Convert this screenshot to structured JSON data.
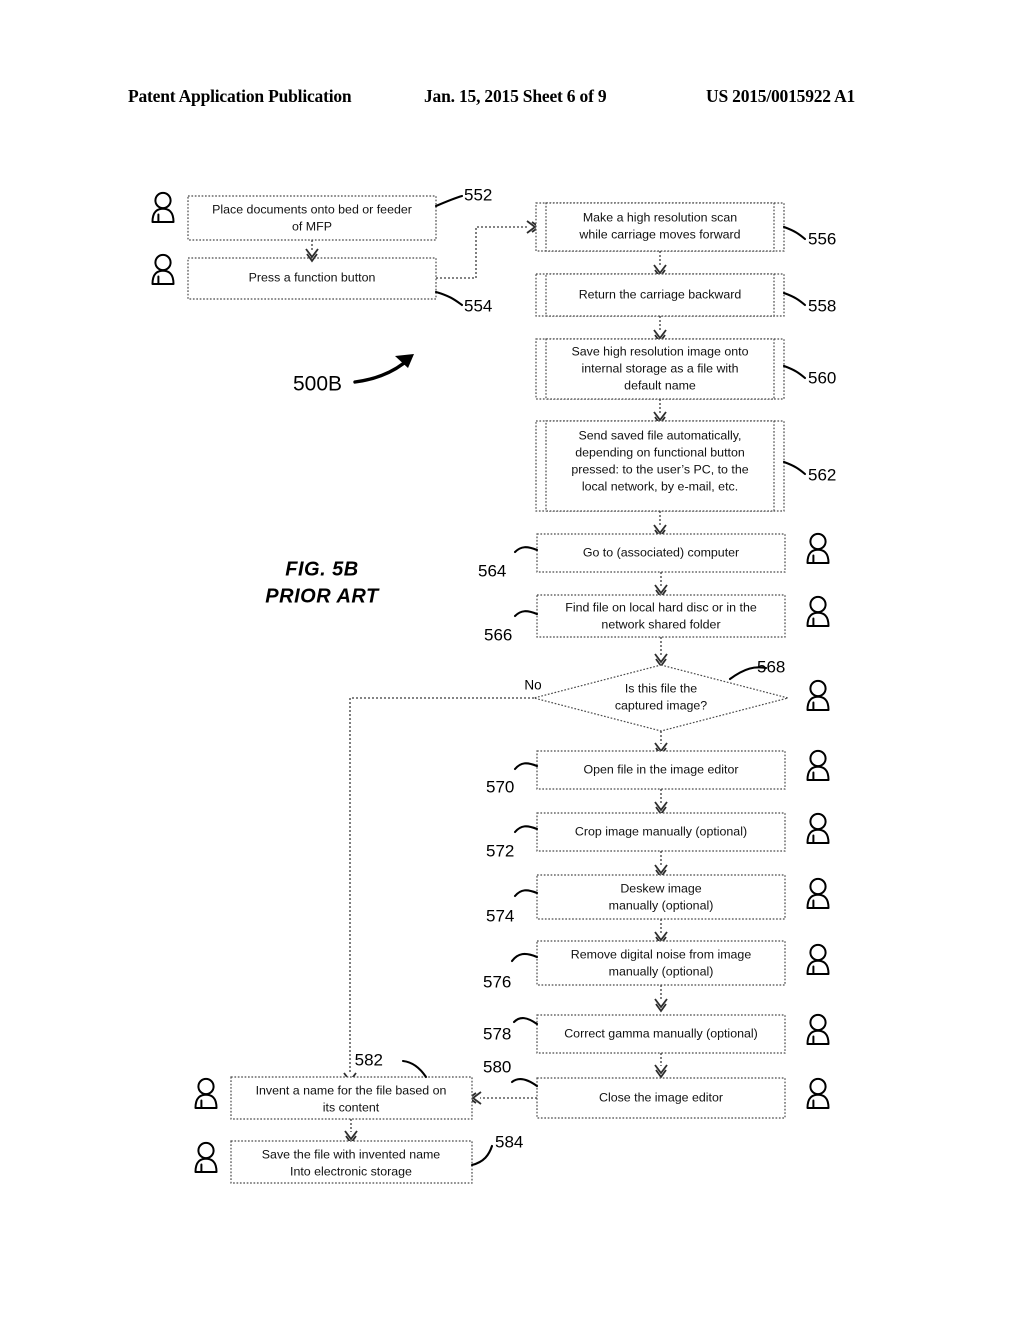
{
  "header": {
    "publication": "Patent Application Publication",
    "date_sheet": "Jan. 15, 2015  Sheet 6 of 9",
    "patent_number": "US 2015/0015922 A1"
  },
  "figure": {
    "label_line1": "FIG. 5B",
    "label_line2": "PRIOR ART",
    "diagram_ref": "500B",
    "no_branch_label": "No"
  },
  "nodes": [
    {
      "ref": "552",
      "type": "process",
      "actor": "person",
      "lines": [
        "Place documents onto bed or feeder",
        "of MFP"
      ]
    },
    {
      "ref": "554",
      "type": "process",
      "actor": "person",
      "lines": [
        "Press a function button"
      ]
    },
    {
      "ref": "556",
      "type": "machine",
      "actor": "none",
      "lines": [
        "Make a high resolution scan",
        "while carriage moves forward"
      ]
    },
    {
      "ref": "558",
      "type": "machine",
      "actor": "none",
      "lines": [
        "Return the carriage backward"
      ]
    },
    {
      "ref": "560",
      "type": "machine",
      "actor": "none",
      "lines": [
        "Save high resolution image onto",
        "internal storage as a file with",
        "default name"
      ]
    },
    {
      "ref": "562",
      "type": "machine",
      "actor": "none",
      "lines": [
        "Send saved file automatically,",
        "depending on functional button",
        "pressed: to the user’s PC, to the",
        "local network, by e-mail, etc."
      ]
    },
    {
      "ref": "564",
      "type": "process",
      "actor": "person",
      "lines": [
        "Go to (associated) computer"
      ]
    },
    {
      "ref": "566",
      "type": "process",
      "actor": "person",
      "lines": [
        "Find file on local hard disc or in the",
        "network shared folder"
      ]
    },
    {
      "ref": "568",
      "type": "decision",
      "actor": "person",
      "lines": [
        "Is this file the",
        "captured image?"
      ]
    },
    {
      "ref": "570",
      "type": "process",
      "actor": "person",
      "lines": [
        "Open file in the image editor"
      ]
    },
    {
      "ref": "572",
      "type": "process",
      "actor": "person",
      "lines": [
        "Crop image manually (optional)"
      ]
    },
    {
      "ref": "574",
      "type": "process",
      "actor": "person",
      "lines": [
        "Deskew image",
        "manually (optional)"
      ]
    },
    {
      "ref": "576",
      "type": "process",
      "actor": "person",
      "lines": [
        "Remove digital noise from image",
        "manually (optional)"
      ]
    },
    {
      "ref": "578",
      "type": "process",
      "actor": "person",
      "lines": [
        "Correct gamma manually (optional)"
      ]
    },
    {
      "ref": "580",
      "type": "process",
      "actor": "person",
      "lines": [
        "Close the image editor"
      ]
    },
    {
      "ref": "582",
      "type": "process",
      "actor": "person",
      "lines": [
        "Invent a name for the file based on",
        "its content"
      ]
    },
    {
      "ref": "584",
      "type": "process",
      "actor": "person",
      "lines": [
        "Save the file with invented name",
        "Into electronic storage"
      ]
    }
  ],
  "colors": {
    "ink": "#000000",
    "box_stroke": "#4a4a4a",
    "connector": "#3a3a3a",
    "background": "#ffffff"
  }
}
